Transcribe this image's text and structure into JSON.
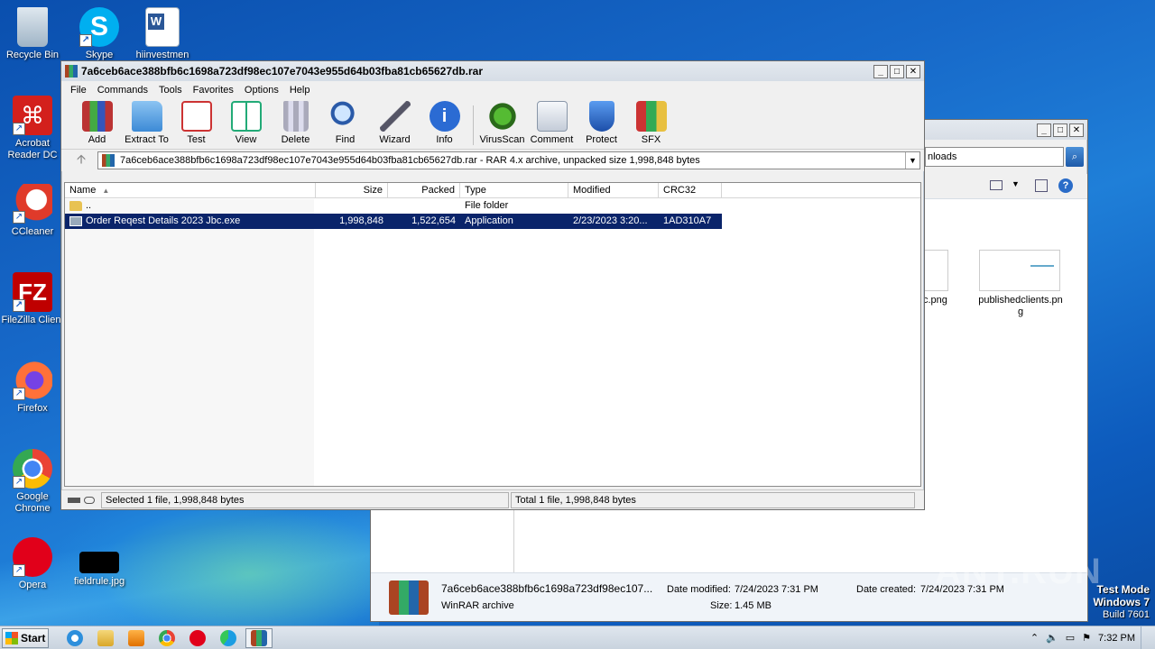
{
  "desktop": {
    "icons": [
      {
        "label": "Recycle Bin"
      },
      {
        "label": "Skype"
      },
      {
        "label": "hiinvestmen"
      },
      {
        "label": "Acrobat Reader DC"
      },
      {
        "label": "CCleaner"
      },
      {
        "label": "FileZilla Client"
      },
      {
        "label": "Firefox"
      },
      {
        "label": "Google Chrome"
      },
      {
        "label": "Opera"
      },
      {
        "label": "fieldrule.jpg"
      }
    ]
  },
  "winrar": {
    "title": "7a6ceb6ace388bfb6c1698a723df98ec107e7043e955d64b03fba81cb65627db.rar",
    "menu": [
      "File",
      "Commands",
      "Tools",
      "Favorites",
      "Options",
      "Help"
    ],
    "tools": [
      "Add",
      "Extract To",
      "Test",
      "View",
      "Delete",
      "Find",
      "Wizard",
      "Info",
      "VirusScan",
      "Comment",
      "Protect",
      "SFX"
    ],
    "address": "7a6ceb6ace388bfb6c1698a723df98ec107e7043e955d64b03fba81cb65627db.rar - RAR 4.x archive, unpacked size 1,998,848 bytes",
    "columns": [
      "Name",
      "Size",
      "Packed",
      "Type",
      "Modified",
      "CRC32"
    ],
    "rows": [
      {
        "name": "..",
        "size": "",
        "packed": "",
        "type": "File folder",
        "modified": "",
        "crc": ""
      },
      {
        "name": "Order Reqest Details 2023 Jbc.exe",
        "size": "1,998,848",
        "packed": "1,522,654",
        "type": "Application",
        "modified": "2/23/2023 3:20...",
        "crc": "1AD310A7"
      }
    ],
    "status_left": "Selected 1 file, 1,998,848 bytes",
    "status_right": "Total 1 file, 1,998,848 bytes"
  },
  "explorer": {
    "search_fragment": "nloads",
    "file1_label": "c.png",
    "file2_label": "publishedclients.png",
    "details_name": "7a6ceb6ace388bfb6c1698a723df98ec107...",
    "details_type": "WinRAR archive",
    "date_modified_label": "Date modified:",
    "date_modified": "7/24/2023 7:31 PM",
    "size_label": "Size:",
    "size": "1.45 MB",
    "date_created_label": "Date created:",
    "date_created": "7/24/2023 7:31 PM"
  },
  "watermark": {
    "line1": "Test Mode",
    "line2": "Windows 7",
    "line3": "Build 7601",
    "brand": "ANY.RUN"
  },
  "taskbar": {
    "start_label": "Start",
    "clock": "7:32 PM"
  }
}
